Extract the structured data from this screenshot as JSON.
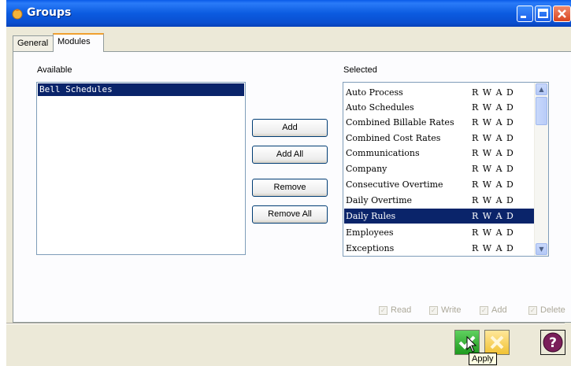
{
  "window": {
    "title": "Groups"
  },
  "tabs": [
    {
      "label": "General"
    },
    {
      "label": "Modules"
    }
  ],
  "available": {
    "label": "Available",
    "items": [
      "Bell Schedules"
    ]
  },
  "buttons": {
    "add": "Add",
    "add_all": "Add All",
    "remove": "Remove",
    "remove_all": "Remove All"
  },
  "selected": {
    "label": "Selected",
    "items": [
      {
        "name": "Auto Process",
        "perms": "R W A D"
      },
      {
        "name": "Auto Schedules",
        "perms": "R W A D"
      },
      {
        "name": "Combined Billable Rates",
        "perms": "R W A D"
      },
      {
        "name": "Combined Cost Rates",
        "perms": "R W A D"
      },
      {
        "name": "Communications",
        "perms": "R W A D"
      },
      {
        "name": "Company",
        "perms": "R W A D"
      },
      {
        "name": "Consecutive Overtime",
        "perms": "R W A D"
      },
      {
        "name": "Daily Overtime",
        "perms": "R W A D"
      },
      {
        "name": "Daily Rules",
        "perms": "R W A D",
        "selected": true
      },
      {
        "name": "Employees",
        "perms": "R W A D"
      },
      {
        "name": "Exceptions",
        "perms": "R W A D"
      }
    ]
  },
  "permissions": {
    "read": "Read",
    "write": "Write",
    "add": "Add",
    "delete": "Delete"
  },
  "footer": {
    "apply_tooltip": "Apply"
  },
  "colors": {
    "selection": "#0a246a",
    "titlebar": "#0a5be8",
    "apply": "#2faa2f",
    "cancel": "#f1c232"
  }
}
